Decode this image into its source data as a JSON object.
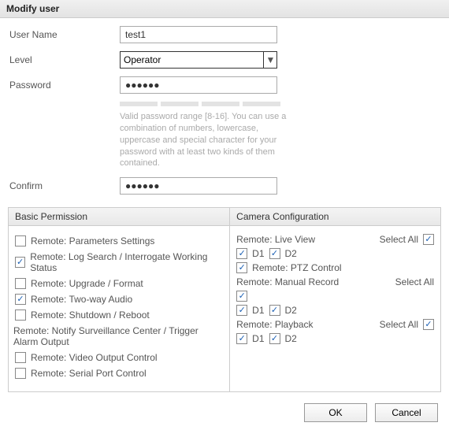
{
  "title": "Modify user",
  "form": {
    "username_label": "User Name",
    "username_value": "test1",
    "level_label": "Level",
    "level_value": "Operator",
    "password_label": "Password",
    "password_mask": "●●●●●●",
    "confirm_label": "Confirm",
    "confirm_mask": "●●●●●●",
    "hint": "Valid password range [8-16]. You can use a combination of numbers, lowercase, uppercase and special character for your password with at least two kinds of them contained."
  },
  "basic": {
    "header": "Basic Permission",
    "items": [
      {
        "label": "Remote: Parameters Settings",
        "checked": false
      },
      {
        "label": "Remote: Log Search / Interrogate Working Status",
        "checked": true
      },
      {
        "label": "Remote: Upgrade / Format",
        "checked": false
      },
      {
        "label": "Remote: Two-way Audio",
        "checked": true
      },
      {
        "label": "Remote: Shutdown / Reboot",
        "checked": false
      }
    ],
    "notify_label": "Remote: Notify Surveillance Center / Trigger Alarm Output",
    "tail": [
      {
        "label": "Remote: Video Output Control",
        "checked": false
      },
      {
        "label": "Remote: Serial Port Control",
        "checked": false
      }
    ]
  },
  "camera": {
    "header": "Camera Configuration",
    "select_all": "Select All",
    "sections": {
      "liveview": {
        "label": "Remote: Live View",
        "all_checked": true,
        "d1_label": "D1",
        "d1_checked": true,
        "d2_label": "D2",
        "d2_checked": true
      },
      "ptz": {
        "label": "Remote: PTZ Control",
        "checked": true
      },
      "manual": {
        "label": "Remote: Manual Record",
        "all_checked": true,
        "d1_label": "D1",
        "d1_checked": true,
        "d2_label": "D2",
        "d2_checked": true
      },
      "playback": {
        "label": "Remote: Playback",
        "all_checked": true,
        "d1_label": "D1",
        "d1_checked": true,
        "d2_label": "D2",
        "d2_checked": true
      }
    }
  },
  "buttons": {
    "ok": "OK",
    "cancel": "Cancel"
  },
  "glyphs": {
    "check": "✓",
    "caret": "▼"
  }
}
